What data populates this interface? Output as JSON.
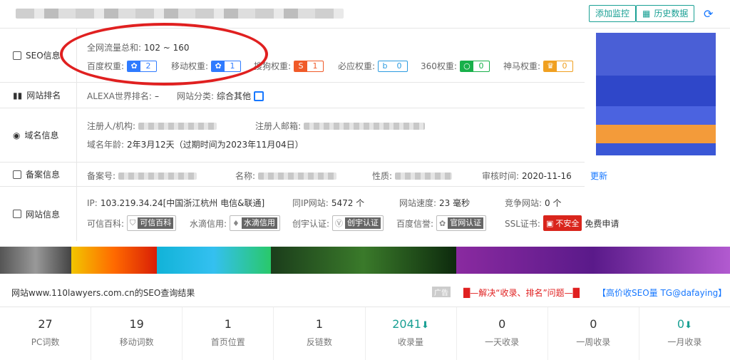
{
  "header": {
    "add_monitor": "添加监控",
    "history": "历史数据"
  },
  "seo": {
    "label": "SEO信息",
    "traffic_label": "全网流量总和:",
    "traffic_value": "102 ~ 160",
    "weights": [
      {
        "name": "百度权重:",
        "value": "2",
        "color": "#2f7bff"
      },
      {
        "name": "移动权重:",
        "value": "1",
        "color": "#2f7bff"
      },
      {
        "name": "搜狗权重:",
        "value": "1",
        "color": "#f05a28"
      },
      {
        "name": "必应权重:",
        "value": "0",
        "color": "#2b9be0"
      },
      {
        "name": "360权重:",
        "value": "0",
        "color": "#18b04a"
      },
      {
        "name": "神马权重:",
        "value": "0",
        "color": "#f0a020"
      }
    ]
  },
  "rank": {
    "label": "网站排名",
    "alexa_label": "ALEXA世界排名:",
    "alexa_value": "–",
    "category_label": "网站分类:",
    "category_value": "综合其他"
  },
  "domain": {
    "label": "域名信息",
    "registrant_label": "注册人/机构:",
    "email_label": "注册人邮箱:",
    "age_label": "域名年龄:",
    "age_value": "2年3月12天（过期时间为2023年11月04日）"
  },
  "icp": {
    "label": "备案信息",
    "number_label": "备案号:",
    "name_label": "名称:",
    "nature_label": "性质:",
    "review_label": "审核时间:",
    "review_value": "2020-11-16",
    "more": "更新"
  },
  "site": {
    "label": "网站信息",
    "ip_label": "IP:",
    "ip_value": "103.219.34.24[中国浙江杭州 电信&联通]",
    "same_ip_label": "同IP网站:",
    "same_ip_value": "5472 个",
    "speed_label": "网站速度:",
    "speed_value": "23 毫秒",
    "compete_label": "竞争网站:",
    "compete_value": "0 个",
    "trust_label": "可信百科:",
    "trust_badge": "可信百科",
    "water_label": "水滴信用:",
    "water_badge": "水滴信用",
    "chuangyu_label": "创宇认证:",
    "chuangyu_badge": "创宇认证",
    "baidu_label": "百度信誉:",
    "baidu_badge": "官网认证",
    "ssl_label": "SSL证书:",
    "ssl_badge": "不安全",
    "ssl_apply": "免费申请"
  },
  "result": {
    "title": "网站www.110lawyers.com.cn的SEO查询结果",
    "ad_tag": "广告",
    "ad_red": "█—解决“收录、排名”问题—█",
    "ad_blue": "【高价收SEO量 TG@dafaying】"
  },
  "stats": [
    {
      "value": "27",
      "label": "PC词数"
    },
    {
      "value": "19",
      "label": "移动词数"
    },
    {
      "value": "1",
      "label": "首页位置"
    },
    {
      "value": "1",
      "label": "反链数"
    },
    {
      "value": "2041",
      "label": "收录量",
      "down": true
    },
    {
      "value": "0",
      "label": "一天收录"
    },
    {
      "value": "0",
      "label": "一周收录"
    },
    {
      "value": "0",
      "label": "一月收录",
      "down": true
    }
  ]
}
